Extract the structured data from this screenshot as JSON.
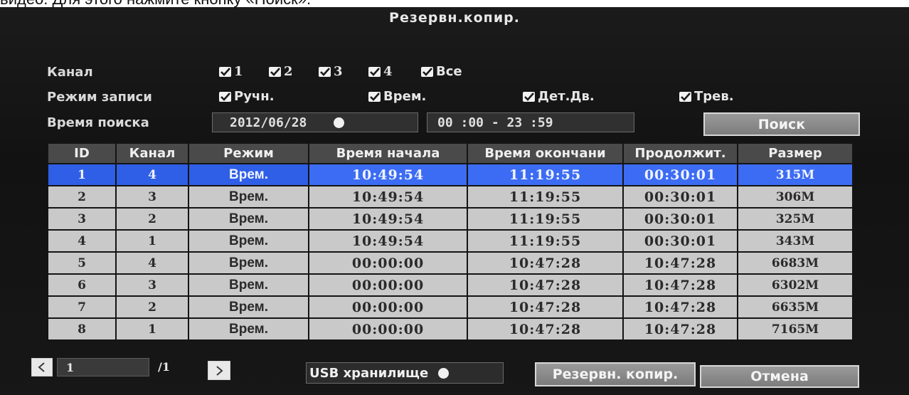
{
  "caption": "видео. Для этого нажмите кнопку «Поиск».",
  "window": {
    "title": "Резервн.копир."
  },
  "filters": {
    "channel_label": "Канал",
    "channels": [
      "1",
      "2",
      "3",
      "4",
      "Все"
    ],
    "mode_label": "Режим записи",
    "modes": [
      "Ручн.",
      "Врем.",
      "Дет.Дв.",
      "Трев."
    ],
    "time_label": "Время поиска",
    "date": "2012/06/28",
    "time_range": "00 :00 - 23 :59",
    "search_button": "Поиск"
  },
  "table": {
    "columns": [
      "ID",
      "Канал",
      "Режим",
      "Время начала",
      "Время окончани",
      "Продолжит.",
      "Размер"
    ],
    "selected_row": 0,
    "rows": [
      [
        "1",
        "4",
        "Врем.",
        "10:49:54",
        "11:19:55",
        "00:30:01",
        "315M"
      ],
      [
        "2",
        "3",
        "Врем.",
        "10:49:54",
        "11:19:55",
        "00:30:01",
        "306M"
      ],
      [
        "3",
        "2",
        "Врем.",
        "10:49:54",
        "11:19:55",
        "00:30:01",
        "325M"
      ],
      [
        "4",
        "1",
        "Врем.",
        "10:49:54",
        "11:19:55",
        "00:30:01",
        "343M"
      ],
      [
        "5",
        "4",
        "Врем.",
        "00:00:00",
        "10:47:28",
        "10:47:28",
        "6683M"
      ],
      [
        "6",
        "3",
        "Врем.",
        "00:00:00",
        "10:47:28",
        "10:47:28",
        "6302M"
      ],
      [
        "7",
        "2",
        "Врем.",
        "00:00:00",
        "10:47:28",
        "10:47:28",
        "6635M"
      ],
      [
        "8",
        "1",
        "Врем.",
        "00:00:00",
        "10:47:28",
        "10:47:28",
        "7165M"
      ]
    ]
  },
  "pager": {
    "prev_icon": "chevron-left-icon",
    "next_icon": "chevron-right-icon",
    "current": "1",
    "total": "/1"
  },
  "footer": {
    "usb_label": "USB хранилище",
    "backup_button": "Резервн. копир.",
    "cancel_button": "Отмена"
  },
  "colors": {
    "selection": "#2f5fe6",
    "row_bg": "#c9c9c9",
    "header_bg": "#4a4a4a",
    "screen_bg": "#161616"
  }
}
